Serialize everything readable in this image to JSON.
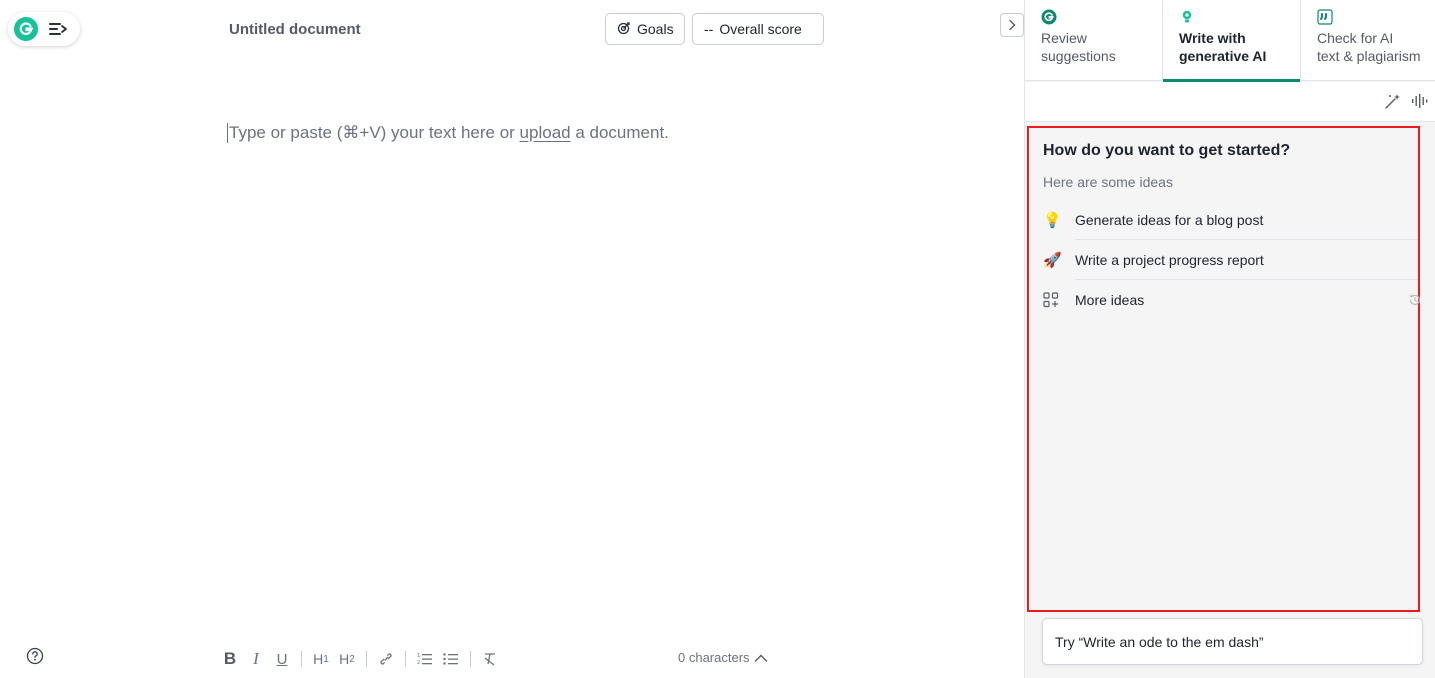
{
  "brand": {
    "logo_icon": "grammarly-g-icon",
    "menu_icon": "menu-collapse-icon",
    "accent": "#15c39a"
  },
  "document": {
    "title": "Untitled document",
    "placeholder_before": "Type or paste (⌘+V) your text here or ",
    "placeholder_link": "upload",
    "placeholder_after": " a document."
  },
  "header": {
    "goals_label": "Goals",
    "score_prefix": "--",
    "score_label": "Overall score"
  },
  "toolbar": {
    "bold": "B",
    "italic": "I",
    "underline": "U",
    "h1": "H",
    "h1_sub": "1",
    "h2": "H",
    "h2_sub": "2"
  },
  "status": {
    "char_count": "0 characters"
  },
  "sidebar": {
    "tabs": [
      {
        "line1": "Review",
        "line2": "suggestions",
        "icon": "grammarly-g-icon",
        "active": false
      },
      {
        "line1": "Write with",
        "line2": "generative AI",
        "icon": "lightbulb-icon",
        "active": true
      },
      {
        "line1": "Check for AI",
        "line2": "text & plagiarism",
        "icon": "quote-icon",
        "active": false
      }
    ],
    "active_tab_color": "#0d8b6f",
    "ideas": {
      "title": "How do you want to get started?",
      "subtitle": "Here are some ideas",
      "items": [
        {
          "emoji": "💡",
          "label": "Generate ideas for a blog post"
        },
        {
          "emoji": "🚀",
          "label": "Write a project progress report"
        },
        {
          "emoji": "grid-plus-icon",
          "label": "More ideas"
        }
      ]
    },
    "prompt": {
      "text": "Try “Write an ode to the em dash”"
    }
  }
}
